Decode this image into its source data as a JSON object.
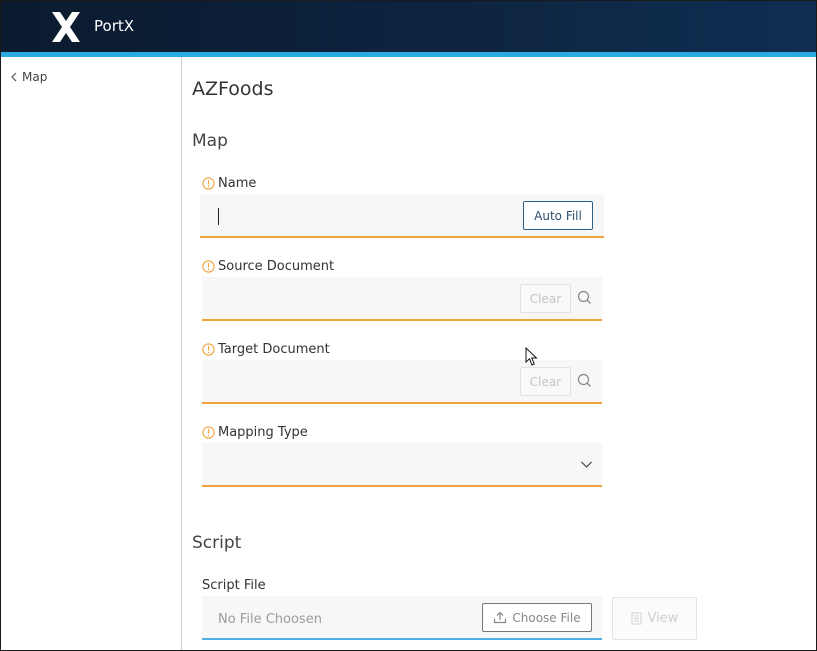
{
  "header": {
    "app_title": "PortX"
  },
  "sidebar": {
    "back_label": "Map"
  },
  "main": {
    "page_title": "AZFoods",
    "map_section": {
      "title": "Map",
      "name": {
        "label": "Name",
        "value": "",
        "auto_fill_label": "Auto Fill"
      },
      "source_document": {
        "label": "Source Document",
        "value": "",
        "clear_label": "Clear"
      },
      "target_document": {
        "label": "Target Document",
        "value": "",
        "clear_label": "Clear"
      },
      "mapping_type": {
        "label": "Mapping Type",
        "selected": ""
      }
    },
    "script_section": {
      "title": "Script",
      "script_file": {
        "label": "Script File",
        "placeholder": "No File Choosen",
        "choose_label": "Choose File",
        "view_label": "View"
      }
    }
  },
  "colors": {
    "header_bg": "#0d2440",
    "header_accent": "#29abe2",
    "required_underline": "#f0a23c",
    "warning_icon": "#f0a23c",
    "primary_button_border": "#2e5f86"
  },
  "icons": [
    "portx-logo",
    "chevron-left-icon",
    "warning-icon",
    "search-icon",
    "chevron-down-icon",
    "upload-icon",
    "document-icon"
  ]
}
